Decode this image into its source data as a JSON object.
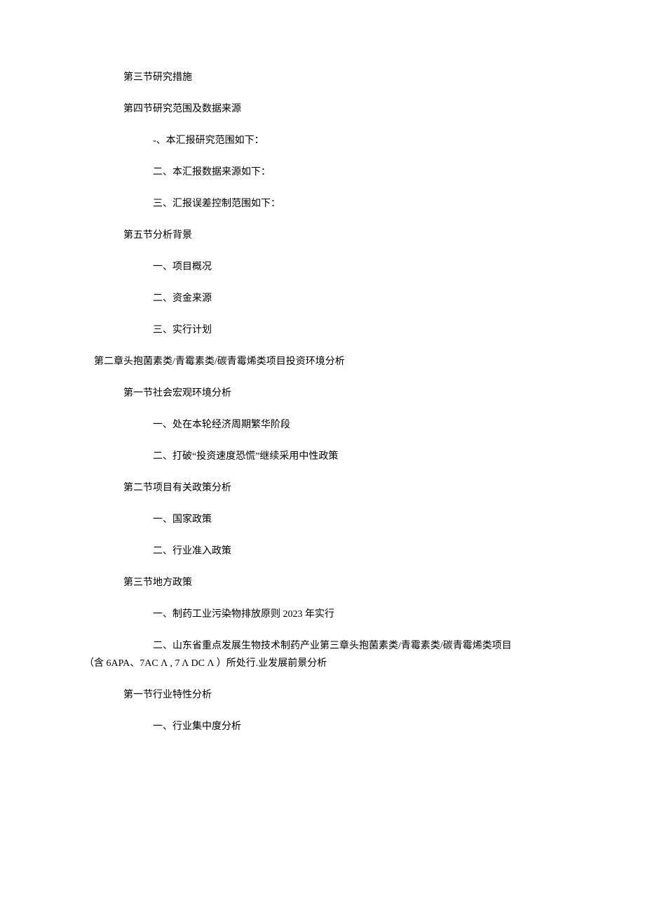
{
  "lines": [
    {
      "cls": "indent-1",
      "text": "第三节研究措施"
    },
    {
      "cls": "indent-1",
      "text": "第四节研究范围及数据来源"
    },
    {
      "cls": "indent-2",
      "text": "-、本汇报研究范围如下："
    },
    {
      "cls": "indent-2",
      "text": "二、本汇报数据来源如下："
    },
    {
      "cls": "indent-2",
      "text": "三、汇报误差控制范围如下："
    },
    {
      "cls": "indent-1",
      "text": "第五节分析背景"
    },
    {
      "cls": "indent-2",
      "text": "一、项目概况"
    },
    {
      "cls": "indent-2",
      "text": "二、资金来源"
    },
    {
      "cls": "indent-2",
      "text": "三、实行计划"
    },
    {
      "cls": "indent-0",
      "text": "第二章头抱菌素类/青霉素类/碳青霉烯类项目投资环境分析"
    },
    {
      "cls": "indent-1",
      "text": "第一节社会宏观环境分析"
    },
    {
      "cls": "indent-2",
      "text": "一、处在本轮经济周期繁华阶段"
    },
    {
      "cls": "indent-2",
      "text": "二、打破“投资速度恐慌”继续采用中性政策"
    },
    {
      "cls": "indent-1",
      "text": "第二节项目有关政策分析"
    },
    {
      "cls": "indent-2",
      "text": "一、国家政策"
    },
    {
      "cls": "indent-2",
      "text": "二、行业准入政策"
    },
    {
      "cls": "indent-1",
      "text": "第三节地方政策"
    },
    {
      "cls": "indent-2",
      "text": "一、制药工业污染物排放原则 2023 年实行"
    },
    {
      "cls": "indent-2 wrap",
      "text": "二、山东省重点发展生物技术制药产业第三章头抱菌素类/青霉素类/碳青霉烯类项目"
    },
    {
      "cls": "wrap-cont",
      "text": "（含 6APA、7AC Λ , 7 Λ DC Λ ）所处行.业发展前景分析"
    },
    {
      "cls": "indent-1",
      "text": "第一节行业特性分析"
    },
    {
      "cls": "indent-2",
      "text": "一、行业集中度分析"
    }
  ]
}
